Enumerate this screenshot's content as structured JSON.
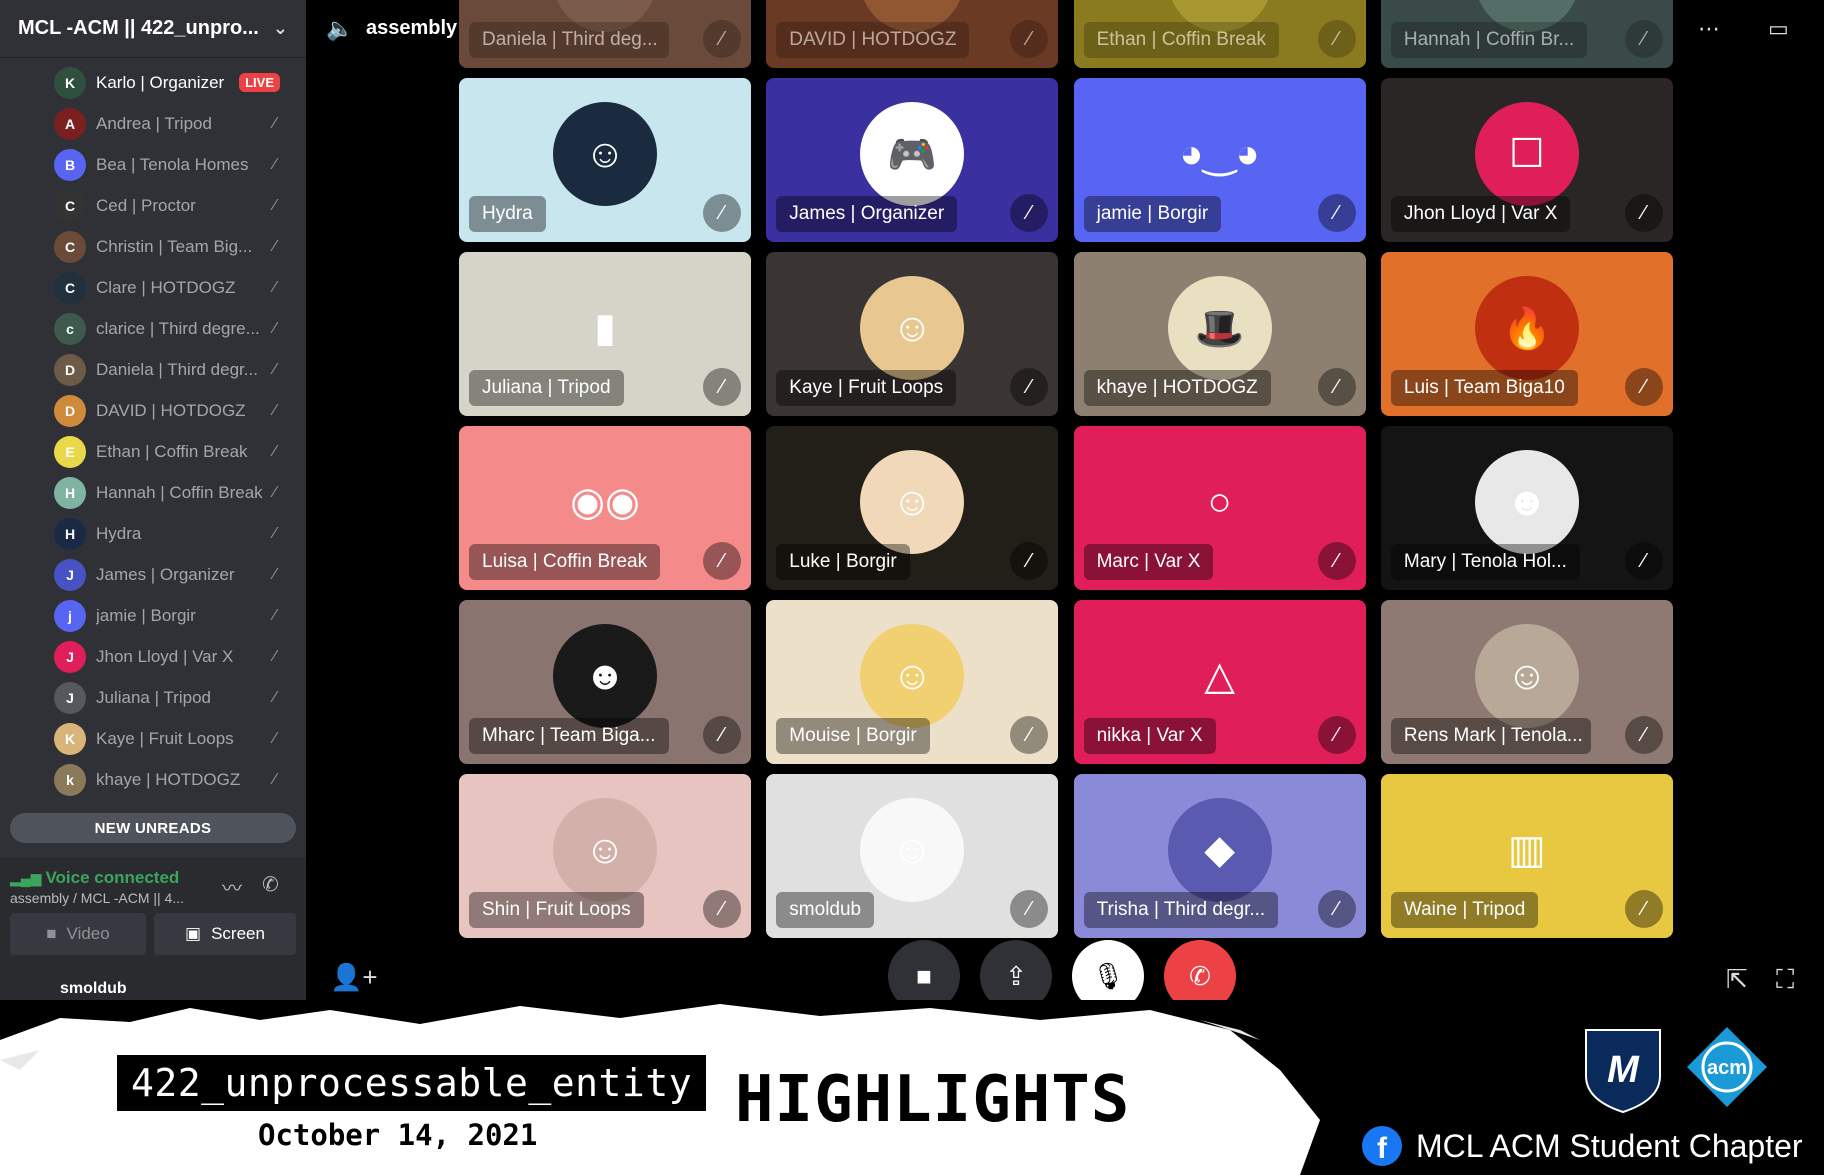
{
  "server": {
    "title": "MCL -ACM || 422_unpro..."
  },
  "channel": {
    "name": "assembly"
  },
  "sidebar": {
    "members": [
      {
        "name": "Karlo | Organizer",
        "badge": "LIVE",
        "color": "#2f4f3f",
        "initial": "K"
      },
      {
        "name": "Andrea | Tripod",
        "color": "#7a2020",
        "initial": "A"
      },
      {
        "name": "Bea | Tenola Homes",
        "color": "#5865f2",
        "initial": "B"
      },
      {
        "name": "Ced | Proctor",
        "color": "#333333",
        "initial": "C"
      },
      {
        "name": "Christin | Team Big...",
        "color": "#6b4a3a",
        "initial": "C"
      },
      {
        "name": "Clare | HOTDOGZ",
        "color": "#22303d",
        "initial": "C"
      },
      {
        "name": "clarice | Third degre...",
        "color": "#3d5a4c",
        "initial": "c"
      },
      {
        "name": "Daniela | Third degr...",
        "color": "#6e5a48",
        "initial": "D"
      },
      {
        "name": "DAVID | HOTDOGZ",
        "color": "#d08a3b",
        "initial": "D"
      },
      {
        "name": "Ethan | Coffin Break",
        "color": "#e8d84a",
        "initial": "E"
      },
      {
        "name": "Hannah | Coffin Break",
        "color": "#7fb3a2",
        "initial": "H"
      },
      {
        "name": "Hydra",
        "color": "#1b2a44",
        "initial": "H"
      },
      {
        "name": "James | Organizer",
        "color": "#4752c4",
        "initial": "J"
      },
      {
        "name": "jamie | Borgir",
        "color": "#5865f2",
        "initial": "j"
      },
      {
        "name": "Jhon Lloyd | Var X",
        "color": "#e01e5a",
        "initial": "J"
      },
      {
        "name": "Juliana | Tripod",
        "color": "#55585e",
        "initial": "J"
      },
      {
        "name": "Kaye | Fruit Loops",
        "color": "#d9b57a",
        "initial": "K"
      },
      {
        "name": "khaye | HOTDOGZ",
        "color": "#8a7a5a",
        "initial": "k"
      }
    ],
    "new_unreads": "NEW UNREADS",
    "voice": {
      "status": "Voice connected",
      "location": "assembly / MCL -ACM || 4...",
      "video_label": "Video",
      "screen_label": "Screen"
    },
    "user": {
      "name": "smoldub"
    }
  },
  "tiles": [
    {
      "name": "Daniela | Third deg...",
      "bg": "#6a4a3a",
      "av": "#8a6a5a",
      "dim": true,
      "icon": "D"
    },
    {
      "name": "DAVID | HOTDOGZ",
      "bg": "#6a3a24",
      "av": "#b07040",
      "dim": true,
      "icon": "D"
    },
    {
      "name": "Ethan | Coffin Break",
      "bg": "#8a7a20",
      "av": "#c0b040",
      "dim": true,
      "icon": "E"
    },
    {
      "name": "Hannah | Coffin Br...",
      "bg": "#3a4a48",
      "av": "#6a8a80",
      "dim": true,
      "icon": "H"
    },
    {
      "name": "Hydra",
      "bg": "#c8e6ee",
      "av": "#1a2a3f",
      "icon": "☺"
    },
    {
      "name": "James | Organizer",
      "bg": "#3a30a0",
      "av": "#ffffff",
      "icon": "🎮"
    },
    {
      "name": "jamie | Borgir",
      "bg": "#5865f2",
      "av": "#5865f2",
      "icon": "◕‿◕"
    },
    {
      "name": "Jhon Lloyd | Var X",
      "bg": "#2a2626",
      "av": "#e01e5a",
      "icon": "☐"
    },
    {
      "name": "Juliana | Tripod",
      "bg": "#d6d4c8",
      "av": "#d6d4c8",
      "icon": "▮"
    },
    {
      "name": "Kaye | Fruit Loops",
      "bg": "#3a3434",
      "av": "#e8c890",
      "icon": "☺"
    },
    {
      "name": "khaye | HOTDOGZ",
      "bg": "#8e8070",
      "av": "#e8e0c0",
      "icon": "🎩"
    },
    {
      "name": "Luis | Team Biga10",
      "bg": "#e0702a",
      "av": "#c03010",
      "icon": "🔥"
    },
    {
      "name": "Luisa | Coffin Break",
      "bg": "#f58a8a",
      "av": "#f58a8a",
      "icon": "◉◉"
    },
    {
      "name": "Luke | Borgir",
      "bg": "#221e18",
      "av": "#f0d8b8",
      "icon": "☺"
    },
    {
      "name": "Marc | Var X",
      "bg": "#e01e5a",
      "av": "#e01e5a",
      "icon": "○"
    },
    {
      "name": "Mary | Tenola Hol...",
      "bg": "#141414",
      "av": "#e8e8e8",
      "icon": "☻"
    },
    {
      "name": "Mharc | Team Biga...",
      "bg": "#8a7470",
      "av": "#1a1a1a",
      "icon": "☻"
    },
    {
      "name": "Mouise | Borgir",
      "bg": "#ece0c8",
      "av": "#f0d070",
      "icon": "☺"
    },
    {
      "name": "nikka | Var X",
      "bg": "#e01e5a",
      "av": "#e01e5a",
      "icon": "△"
    },
    {
      "name": "Rens Mark | Tenola...",
      "bg": "#8e7a72",
      "av": "#b8a898",
      "icon": "☺"
    },
    {
      "name": "Shin | Fruit Loops",
      "bg": "#e8c4c0",
      "av": "#d4b0aa",
      "icon": "☺"
    },
    {
      "name": "smoldub",
      "bg": "#e0e0e0",
      "av": "#f8f8f8",
      "icon": "☺"
    },
    {
      "name": "Trisha | Third degr...",
      "bg": "#8a8ad8",
      "av": "#5a5ab0",
      "icon": "◆"
    },
    {
      "name": "Waine | Tripod",
      "bg": "#e8c840",
      "av": "#e8c840",
      "icon": "▥"
    }
  ],
  "banner": {
    "room": "422_unprocessable_entity",
    "date": "October 14, 2021",
    "title": "HIGHLIGHTS",
    "org": "MCL ACM Student Chapter",
    "logo_acm": "acm",
    "logo_mcl": "M"
  },
  "colors": {
    "accent": "#5865f2",
    "live": "#ed4245",
    "connected": "#3ba55d",
    "hangup": "#ed4245"
  }
}
